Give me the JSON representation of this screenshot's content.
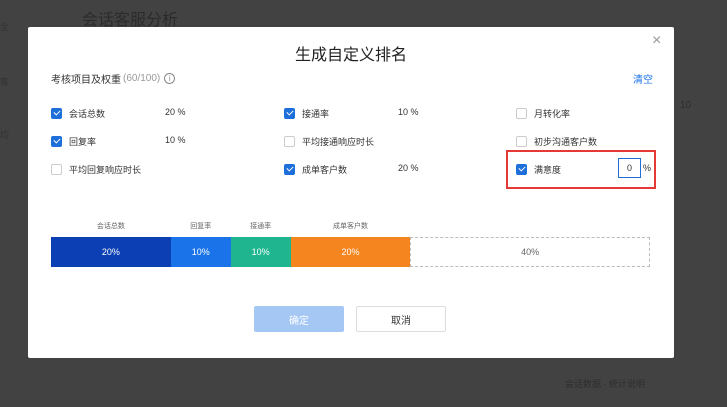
{
  "background": {
    "title": "会话客服分析",
    "side_1": "全",
    "side_2": "客",
    "side_3": "均",
    "right_text": "10",
    "footer_text": "会话数据 · 统计说明"
  },
  "modal": {
    "title": "生成自定义排名",
    "section_label": "考核项目及权重",
    "section_count": "(60/100)",
    "info_glyph": "i",
    "clear_label": "清空",
    "close_glyph": "×",
    "confirm_label": "确定",
    "cancel_label": "取消"
  },
  "metrics": [
    {
      "label": "会话总数",
      "checked": true,
      "weight": "20 %"
    },
    {
      "label": "接通率",
      "checked": true,
      "weight": "10 %"
    },
    {
      "label": "月转化率",
      "checked": false,
      "weight": ""
    },
    {
      "label": "回复率",
      "checked": true,
      "weight": "10 %"
    },
    {
      "label": "平均接通响应时长",
      "checked": false,
      "weight": ""
    },
    {
      "label": "初步沟通客户数",
      "checked": false,
      "weight": ""
    },
    {
      "label": "平均回复响应时长",
      "checked": false,
      "weight": ""
    },
    {
      "label": "成单客户数",
      "checked": true,
      "weight": "20 %"
    },
    {
      "label": "满意度",
      "checked": true,
      "weight": ""
    }
  ],
  "satisfaction_input": {
    "value": "0",
    "unit": "%"
  },
  "distribution": {
    "segments": [
      {
        "label": "会话总数",
        "value_text": "20%",
        "percent": 20,
        "color": "#0b3fb3"
      },
      {
        "label": "回复率",
        "value_text": "10%",
        "percent": 10,
        "color": "#1a73e8"
      },
      {
        "label": "接通率",
        "value_text": "10%",
        "percent": 10,
        "color": "#1eb58f"
      },
      {
        "label": "成单客户数",
        "value_text": "20%",
        "percent": 20,
        "color": "#f5851f"
      }
    ],
    "remaining_text": "40%",
    "remaining_percent": 40
  }
}
